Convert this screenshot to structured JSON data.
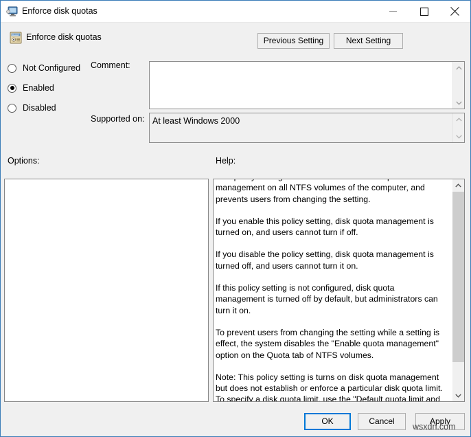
{
  "window": {
    "title": "Enforce disk quotas",
    "title_icon": "monitor-computer-icon",
    "controls": {
      "minimize": "minimize-icon",
      "maximize": "maximize-icon",
      "close": "close-icon"
    },
    "accent_color": "#0078d7",
    "border_color": "#3a7cb8",
    "background_color": "#f0f0f0"
  },
  "header": {
    "title": "Enforce disk quotas",
    "icon": "policy-setting-icon",
    "previous_setting_label": "Previous Setting",
    "next_setting_label": "Next Setting"
  },
  "state_options": [
    {
      "label": "Not Configured",
      "selected": false
    },
    {
      "label": "Enabled",
      "selected": true
    },
    {
      "label": "Disabled",
      "selected": false
    }
  ],
  "comment": {
    "label": "Comment:",
    "value": "",
    "placeholder": ""
  },
  "supported_on": {
    "label": "Supported on:",
    "value": "At least Windows 2000"
  },
  "options": {
    "label": "Options:",
    "items": []
  },
  "help": {
    "label": "Help:",
    "paragraphs": [
      "This policy setting turns on and turns off disk quota management on all NTFS volumes of the computer, and prevents users from changing the setting.",
      "If you enable this policy setting, disk quota management is turned on, and users cannot turn if off.",
      "If you disable the policy setting, disk quota management is turned off, and users cannot turn it on.",
      "If this policy setting is not configured, disk quota management is turned  off by default, but administrators can turn it on.",
      "To prevent users from changing the setting while a setting is effect, the system disables the \"Enable quota management\" option on the Quota tab of NTFS volumes.",
      "Note: This policy setting is turns on disk quota management but does not establish or enforce a particular disk quota limit. To specify a disk quota limit, use the \"Default quota limit and warning level\" policy setting. Otherwise, the system uses the physical space on the volume as the quota limit."
    ]
  },
  "footer": {
    "ok_label": "OK",
    "cancel_label": "Cancel",
    "apply_label": "Apply"
  },
  "watermark": "wsxdn.com"
}
